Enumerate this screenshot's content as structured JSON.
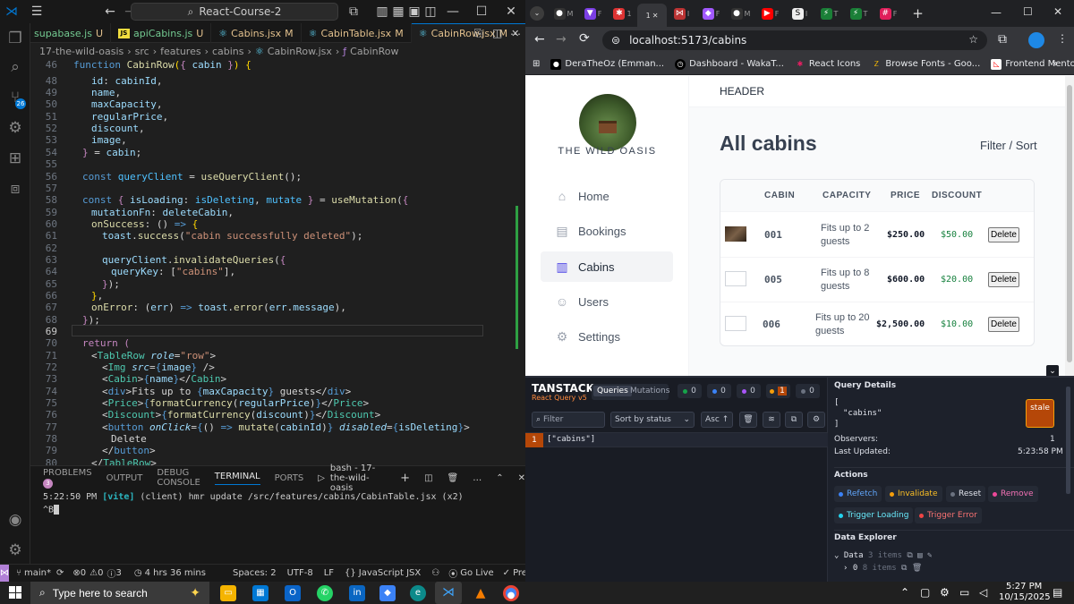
{
  "vscode": {
    "title_search": "React-Course-2",
    "tabs": [
      {
        "label": "supabase.js",
        "mark": "U",
        "type": "js"
      },
      {
        "label": "apiCabins.js",
        "mark": "U",
        "type": "js"
      },
      {
        "label": "Cabins.jsx",
        "mark": "M",
        "type": "react"
      },
      {
        "label": "CabinTable.jsx",
        "mark": "M",
        "type": "react"
      },
      {
        "label": "CabinRow.jsx",
        "mark": "M",
        "type": "react",
        "active": true
      }
    ],
    "breadcrumb": [
      "17-the-wild-oasis",
      "src",
      "features",
      "cabins",
      "CabinRow.jsx",
      "CabinRow"
    ],
    "scm_badge": "26",
    "code_lines": [
      "46",
      "48",
      "49",
      "50",
      "51",
      "52",
      "53",
      "54",
      "55",
      "56",
      "57",
      "58",
      "59",
      "60",
      "61",
      "62",
      "63",
      "64",
      "65",
      "66",
      "67",
      "68",
      "69",
      "70",
      "71",
      "72",
      "73",
      "74",
      "75",
      "76",
      "77",
      "78",
      "79",
      "80"
    ],
    "panel": {
      "tabs": [
        "PROBLEMS",
        "OUTPUT",
        "DEBUG CONSOLE",
        "TERMINAL",
        "PORTS"
      ],
      "problems_count": "3",
      "terminal_name": "bash - 17-the-wild-oasis",
      "terminal_time": "5:22:50 PM",
      "terminal_tag": "[vite]",
      "terminal_msg": "(client) hmr update /src/features/cabins/CabinTable.jsx (x2)",
      "terminal_prompt": "^B"
    },
    "status": {
      "branch": "main*",
      "errors": "0",
      "warnings": "0",
      "info": "3",
      "time": "4 hrs 36 mins",
      "spaces": "Spaces: 2",
      "encoding": "UTF-8",
      "eol": "LF",
      "lang": "JavaScript JSX",
      "golive": "Go Live",
      "prettier": "Prettier"
    }
  },
  "chrome": {
    "tab_labels": [
      "M",
      "F",
      "1",
      "I",
      "F",
      "M",
      "F",
      "I",
      "T",
      "F"
    ],
    "url": "localhost:5173/cabins",
    "bookmarks": [
      "DeraTheOz (Emman...",
      "Dashboard - WakaT...",
      "React Icons",
      "Browse Fonts - Goo...",
      "Frontend Mentor | F..."
    ]
  },
  "app": {
    "brand": "THE WILD OASIS",
    "header": "HEADER",
    "title": "All cabins",
    "filter_sort": "Filter / Sort",
    "nav": [
      {
        "label": "Home",
        "icon": "home-icon"
      },
      {
        "label": "Bookings",
        "icon": "calendar-icon"
      },
      {
        "label": "Cabins",
        "icon": "building-icon",
        "active": true
      },
      {
        "label": "Users",
        "icon": "users-icon"
      },
      {
        "label": "Settings",
        "icon": "gear-icon"
      }
    ],
    "table": {
      "headers": [
        "CABIN",
        "CAPACITY",
        "PRICE",
        "DISCOUNT"
      ],
      "rows": [
        {
          "name": "001",
          "capacity": "Fits up to 2 guests",
          "price": "$250.00",
          "discount": "$50.00",
          "action": "Delete",
          "has_image": true
        },
        {
          "name": "005",
          "capacity": "Fits up to 8 guests",
          "price": "$600.00",
          "discount": "$20.00",
          "action": "Delete",
          "has_image": false
        },
        {
          "name": "006",
          "capacity": "Fits up to 20 guests",
          "price": "$2,500.00",
          "discount": "$10.00",
          "action": "Delete",
          "has_image": false
        }
      ]
    }
  },
  "devtools": {
    "brand": "TANSTACK",
    "sub": "React Query v5",
    "tabs": [
      "Queries",
      "Mutations"
    ],
    "counts": [
      "0",
      "0",
      "0",
      "1",
      "0"
    ],
    "filter_placeholder": "Filter",
    "sort": "Sort by status",
    "asc": "Asc",
    "query_count": "1",
    "query_key": "[\"cabins\"]",
    "details_title": "Query Details",
    "details_key_open": "[",
    "details_key": "\"cabins\"",
    "details_key_close": "]",
    "status": "stale",
    "observers_label": "Observers:",
    "observers": "1",
    "updated_label": "Last Updated:",
    "updated": "5:23:58 PM",
    "actions_title": "Actions",
    "actions": [
      "Refetch",
      "Invalidate",
      "Reset",
      "Remove",
      "Trigger Loading",
      "Trigger Error"
    ],
    "explorer_title": "Data Explorer",
    "data_label": "Data",
    "data_items": "3 items",
    "data_sub": "0",
    "data_sub_items": "8 items"
  },
  "taskbar": {
    "search_placeholder": "Type here to search",
    "time": "5:27 PM",
    "date": "10/15/2025"
  }
}
